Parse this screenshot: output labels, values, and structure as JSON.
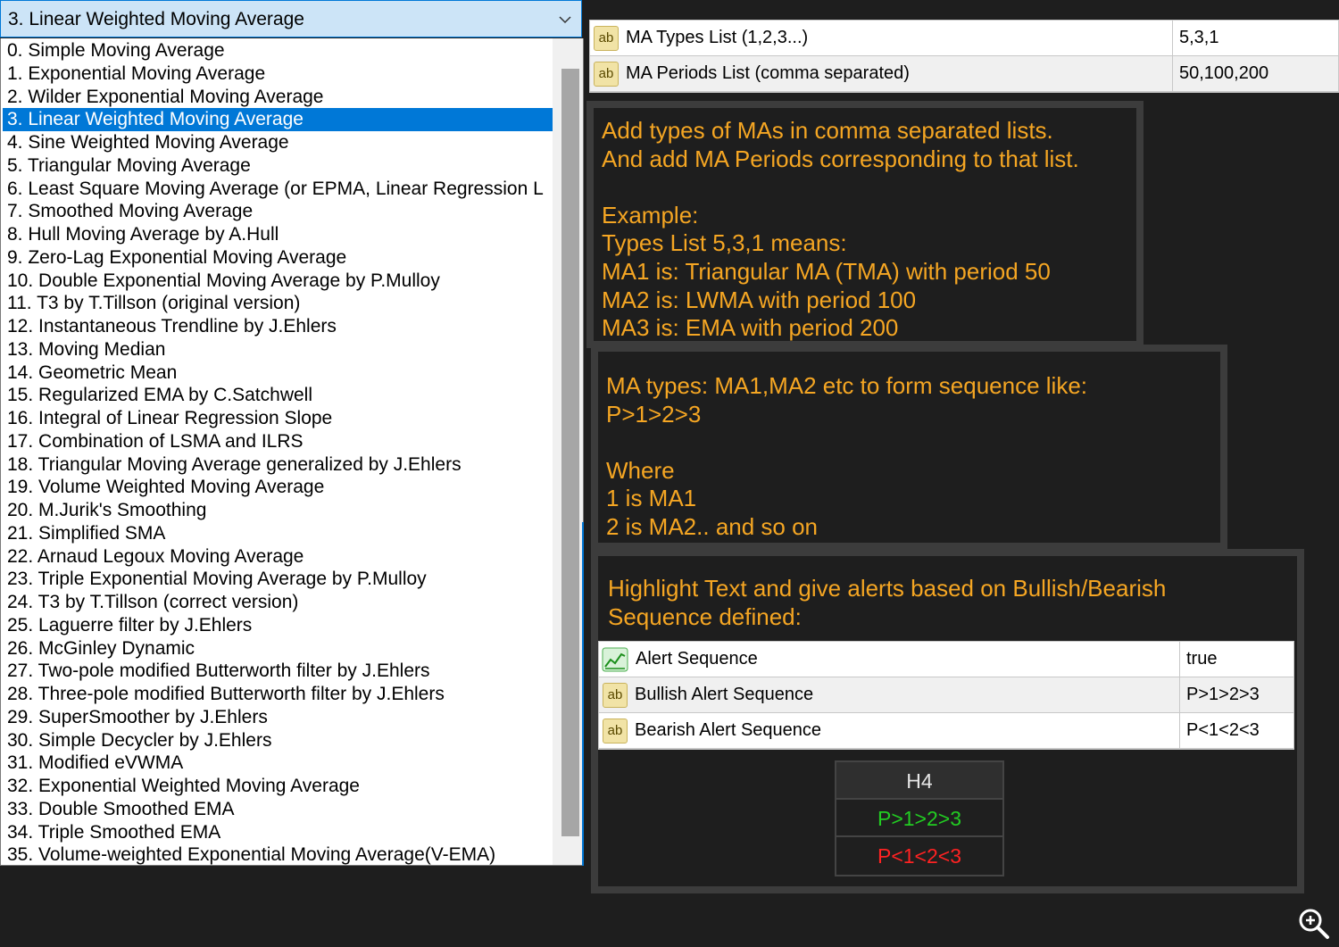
{
  "dropdown": {
    "selected": "3. Linear Weighted Moving Average",
    "selected_index": 3,
    "options": [
      "0. Simple Moving Average",
      "1. Exponential Moving Average",
      "2. Wilder Exponential Moving Average",
      "3. Linear Weighted Moving Average",
      "4. Sine Weighted Moving Average",
      "5. Triangular Moving Average",
      "6. Least Square Moving Average (or EPMA, Linear Regression L",
      "7. Smoothed Moving Average",
      "8. Hull Moving Average by A.Hull",
      "9. Zero-Lag Exponential Moving Average",
      "10. Double Exponential Moving Average by P.Mulloy",
      "11. T3 by T.Tillson (original version)",
      "12. Instantaneous Trendline by J.Ehlers",
      "13. Moving Median",
      "14. Geometric Mean",
      "15. Regularized EMA by C.Satchwell",
      "16. Integral of Linear Regression Slope",
      "17. Combination of LSMA and ILRS",
      "18. Triangular Moving Average generalized by J.Ehlers",
      "19. Volume Weighted Moving Average",
      "20. M.Jurik's Smoothing",
      "21. Simplified SMA",
      "22. Arnaud Legoux Moving Average",
      "23. Triple Exponential Moving Average by P.Mulloy",
      "24. T3 by T.Tillson (correct version)",
      "25. Laguerre filter by J.Ehlers",
      "26. McGinley Dynamic",
      "27. Two-pole modified Butterworth filter by J.Ehlers",
      "28. Three-pole modified Butterworth filter by J.Ehlers",
      "29. SuperSmoother by J.Ehlers",
      "30. Simple Decycler by J.Ehlers",
      "31. Modified eVWMA",
      "32. Exponential Weighted Moving Average",
      "33. Double Smoothed EMA",
      "34. Triple Smoothed EMA",
      "35. Volume-weighted Exponential Moving Average(V-EMA)"
    ]
  },
  "params": [
    {
      "icon": "ab",
      "name": "MA Types List (1,2,3...)",
      "value": "5,3,1"
    },
    {
      "icon": "ab",
      "name": "MA Periods List (comma separated)",
      "value": "50,100,200"
    }
  ],
  "info1": [
    "Add types of MAs in comma separated lists.",
    "And add MA Periods corresponding to that list.",
    "",
    "Example:",
    "Types List 5,3,1 means:",
    "MA1 is: Triangular MA (TMA) with period 50",
    "MA2 is: LWMA with period 100",
    "MA3 is: EMA with period 200"
  ],
  "info2": [
    "MA types: MA1,MA2 etc to form sequence like:",
    "P>1>2>3",
    "",
    "Where",
    "1 is MA1",
    "2 is MA2.. and so on"
  ],
  "info3": [
    "Highlight Text and give alerts based on Bullish/Bearish",
    "Sequence defined:"
  ],
  "alerts": [
    {
      "icon": "chart",
      "name": "Alert Sequence",
      "value": "true"
    },
    {
      "icon": "ab",
      "name": "Bullish Alert Sequence",
      "value": "P>1>2>3"
    },
    {
      "icon": "ab",
      "name": "Bearish Alert Sequence",
      "value": "P<1<2<3"
    }
  ],
  "status": {
    "timeframe": "H4",
    "bullish": "P>1>2>3",
    "bearish": "P<1<2<3"
  },
  "colors": {
    "info_text": "#f5a623",
    "bullish": "#22cc22",
    "bearish": "#ff2222",
    "selection": "#0078d7"
  }
}
